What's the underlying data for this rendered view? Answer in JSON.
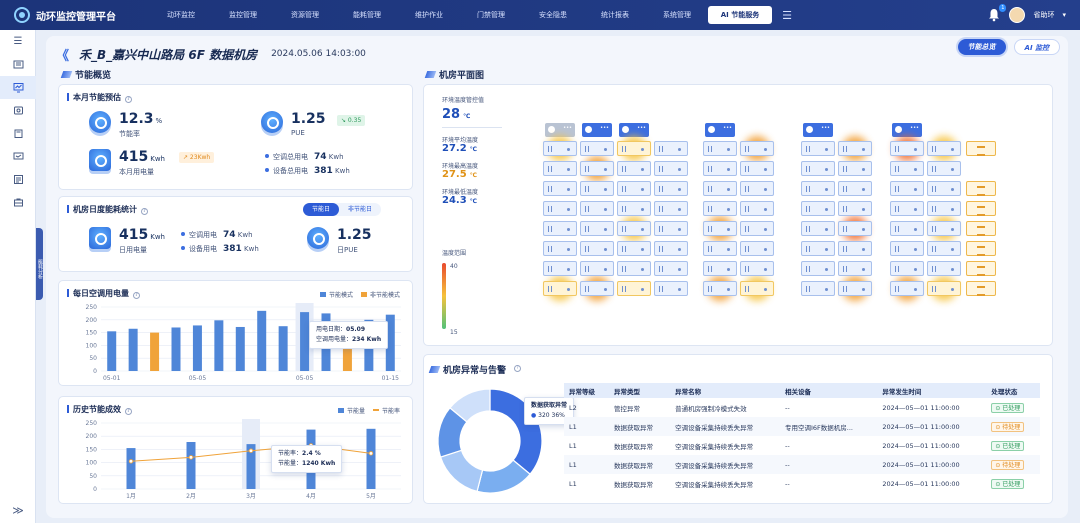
{
  "app": {
    "title": "动环监控管理平台"
  },
  "nav": {
    "items": [
      "动环监控",
      "监控管理",
      "资源管理",
      "能耗管理",
      "维护作业",
      "门禁管理",
      "安全隐患",
      "统计报表",
      "系统管理"
    ],
    "active": "AI 节能服务"
  },
  "user": {
    "name": "省助环",
    "notifications": "1"
  },
  "side_tab": "能耗分析",
  "page": {
    "title": "禾_B_嘉兴中山路局 6F 数据机房",
    "datetime": "2024.05.06  14:03:00",
    "btn_energy": "节能总览",
    "btn_ai": "AI 监控"
  },
  "overview": {
    "title": "节能概览"
  },
  "monthly": {
    "title": "本月节能预估",
    "rate_value": "12.3",
    "rate_unit": "%",
    "rate_label": "节能率",
    "pue_value": "1.25",
    "pue_label": "PUE",
    "pue_delta": "↘ 0.35",
    "power_value": "415",
    "power_unit": "Kwh",
    "power_label": "本月用电量",
    "power_delta": "↗ 23Kwh",
    "ac_label": "空调总用电",
    "ac_value": "74",
    "ac_unit": "Kwh",
    "dev_label": "设备总用电",
    "dev_value": "381",
    "dev_unit": "Kwh"
  },
  "daily": {
    "title": "机房日度能耗统计",
    "seg_on": "节能日",
    "seg_off": "非节能日",
    "power_value": "415",
    "power_unit": "Kwh",
    "power_label": "日用电量",
    "ac_label": "空调用电",
    "ac_value": "74",
    "ac_unit": "Kwh",
    "dev_label": "设备用电",
    "dev_value": "381",
    "dev_unit": "Kwh",
    "pue_value": "1.25",
    "pue_label": "日PUE"
  },
  "ac_chart": {
    "title": "每日空调用电量",
    "legend": [
      "节能模式",
      "非节能模式"
    ],
    "tooltip": {
      "l1": "用电日期：",
      "v1": "05.09",
      "l2": "空调用电量：",
      "v2": "234 Kwh"
    }
  },
  "hist_chart": {
    "title": "历史节能成效",
    "legend": [
      "节能量",
      "节能率"
    ],
    "tooltip": {
      "l1": "节能率：",
      "v1": "2.4 %",
      "l2": "节能量：",
      "v2": "1240 Kwh"
    }
  },
  "chart_data": [
    {
      "type": "bar",
      "title": "每日空调用电量",
      "ylim": [
        0,
        250
      ],
      "yticks": [
        0,
        50,
        100,
        150,
        200,
        250
      ],
      "xtick_labels": [
        "05-01",
        "05-05",
        "05-05",
        "01-15"
      ],
      "series": [
        {
          "name": "节能模式",
          "values": [
            155,
            165,
            null,
            170,
            178,
            198,
            172,
            235,
            175,
            230,
            225,
            null,
            200,
            220
          ]
        },
        {
          "name": "非节能模式",
          "values": [
            null,
            null,
            150,
            null,
            null,
            null,
            null,
            null,
            null,
            null,
            null,
            160,
            null,
            null
          ]
        }
      ],
      "highlight_index": 9
    },
    {
      "type": "bar",
      "title": "历史节能成效",
      "ylim": [
        0,
        250
      ],
      "yticks": [
        0,
        50,
        100,
        150,
        200,
        250
      ],
      "categories": [
        "1月",
        "2月",
        "3月",
        "4月",
        "5月"
      ],
      "series": [
        {
          "name": "节能量",
          "values": [
            155,
            178,
            170,
            225,
            228
          ]
        },
        {
          "name": "节能率",
          "values": [
            105,
            120,
            145,
            165,
            135
          ]
        }
      ]
    }
  ],
  "floor": {
    "title": "机房平面图",
    "env_title": "环境温度管控值",
    "env_value": "28",
    "env_unit": "℃",
    "avg_label": "环境平均温度",
    "avg_value": "27.2",
    "avg_unit": "℃",
    "max_label": "环境最高温度",
    "max_value": "27.5",
    "max_unit": "℃",
    "min_label": "环境最低温度",
    "min_value": "24.3",
    "min_unit": "℃",
    "range_label": "温度范围",
    "range_max": "40",
    "range_min": "15",
    "ac_text": "•••"
  },
  "alarm": {
    "title": "机房异常与告警",
    "donut_tip_title": "数据获取异常",
    "donut_tip_value": "320",
    "donut_tip_pct": "36%",
    "headers": [
      "异常等级",
      "异常类型",
      "异常名称",
      "相关设备",
      "异常发生时间",
      "处理状态"
    ],
    "rows": [
      [
        "L2",
        "管控异常",
        "普通机房强制冷模式失效",
        "--",
        "2024—05—01 11:00:00",
        "已处理",
        "ok"
      ],
      [
        "L1",
        "数据获取异常",
        "空调设备采集持续丢失异常",
        "专用空调I6F数据机房...",
        "2024—05—01 11:00:00",
        "待处理",
        "wait"
      ],
      [
        "L1",
        "数据获取异常",
        "空调设备采集持续丢失异常",
        "--",
        "2024—05—01 11:00:00",
        "已处理",
        "ok"
      ],
      [
        "L1",
        "数据获取异常",
        "空调设备采集持续丢失异常",
        "--",
        "2024—05—01 11:00:00",
        "待处理",
        "wait"
      ],
      [
        "L1",
        "数据获取异常",
        "空调设备采集持续丢失异常",
        "--",
        "2024—05—01 11:00:00",
        "已处理",
        "ok"
      ]
    ]
  },
  "colors": {
    "accent": "#2d5bd6",
    "bar": "#4f86d8",
    "bar_alt": "#f0a33a",
    "line": "#f0a33a",
    "ok": "#2f9a5c",
    "wait": "#e08a1d"
  }
}
